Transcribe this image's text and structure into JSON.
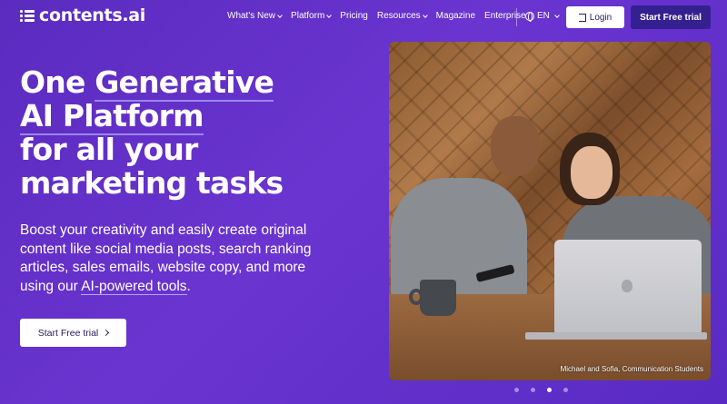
{
  "brand": {
    "name": "contents.ai"
  },
  "nav": {
    "items": [
      {
        "label": "What's New",
        "dropdown": true
      },
      {
        "label": "Platform",
        "dropdown": true
      },
      {
        "label": "Pricing",
        "dropdown": false
      },
      {
        "label": "Resources",
        "dropdown": true
      },
      {
        "label": "Magazine",
        "dropdown": false
      },
      {
        "label": "Enterprise",
        "dropdown": false
      }
    ],
    "language": "EN",
    "login_label": "Login",
    "trial_label": "Start Free trial"
  },
  "hero": {
    "headline_line1_a": "One ",
    "headline_line1_b": "Generative",
    "headline_line2": "AI Platform",
    "headline_line3": "for all your",
    "headline_line4": "marketing tasks",
    "subtext_main": "Boost your creativity and easily create original content like social media posts, search ranking articles, sales emails, website copy, and more using our ",
    "subtext_link": "AI-powered tools",
    "subtext_end": ".",
    "cta_label": "Start Free trial"
  },
  "photo": {
    "caption": "Michael and Sofia, Communication Students"
  },
  "carousel": {
    "count": 4,
    "active_index": 2
  },
  "colors": {
    "background": "#5b2bbf",
    "trial_button": "#34218f",
    "underline": "#9a86f0"
  }
}
